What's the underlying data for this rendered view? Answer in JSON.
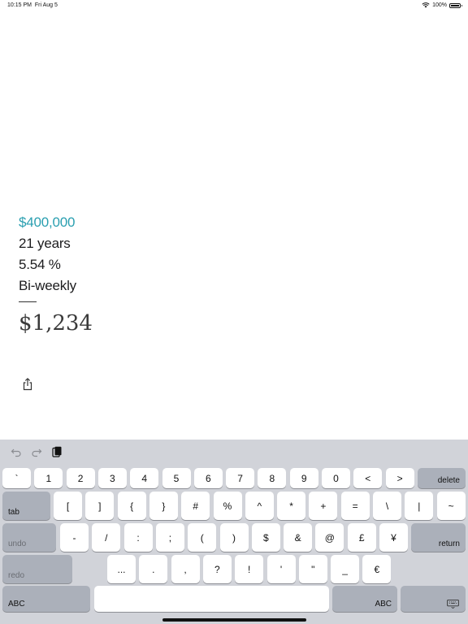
{
  "status_bar": {
    "time": "10:15 PM",
    "date": "Fri Aug 5",
    "battery": "100%"
  },
  "calculator": {
    "amount": "$400,000",
    "term": "21 years",
    "rate": "5.54 %",
    "frequency": "Bi-weekly",
    "payment": "$1,234"
  },
  "colors": {
    "accent": "#2a9fb0"
  },
  "keyboard": {
    "row1": [
      "`",
      "1",
      "2",
      "3",
      "4",
      "5",
      "6",
      "7",
      "8",
      "9",
      "0",
      "<",
      ">"
    ],
    "delete": "delete",
    "tab": "tab",
    "row2": [
      "[",
      "]",
      "{",
      "}",
      "#",
      "%",
      "^",
      "*",
      "+",
      "=",
      "\\",
      "|",
      "~"
    ],
    "undo": "undo",
    "row3": [
      "-",
      "/",
      ":",
      ";",
      "(",
      ")",
      "$",
      "&",
      "@",
      "£",
      "¥"
    ],
    "return": "return",
    "redo": "redo",
    "row4": [
      "...",
      ".",
      ",",
      "?",
      "!",
      "'",
      "\"",
      "_",
      "€"
    ],
    "abc_left": "ABC",
    "abc_right": "ABC"
  },
  "icons": {
    "undo": "undo-arrow-icon",
    "redo": "redo-arrow-icon",
    "paste": "clipboard-icon",
    "share": "share-icon",
    "hide_keyboard": "keyboard-hide-icon"
  }
}
